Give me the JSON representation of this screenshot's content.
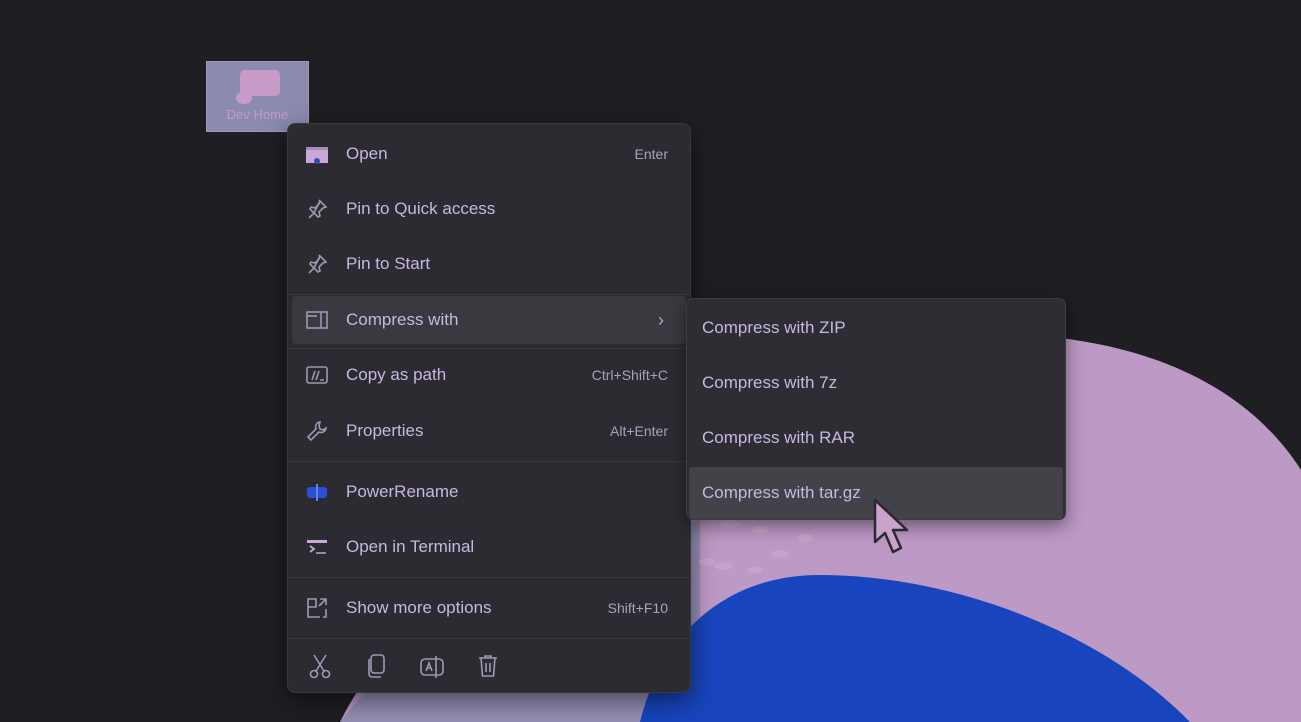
{
  "desktop": {
    "background_color": "#1f1e23",
    "selected_icon": {
      "label": "Dev Home",
      "icon": "dev-home-icon"
    }
  },
  "context_menu": {
    "items": [
      {
        "label": "Open",
        "shortcut": "Enter",
        "icon": "folder-open-icon"
      },
      {
        "label": "Pin to Quick access",
        "shortcut": "",
        "icon": "pin-icon"
      },
      {
        "label": "Pin to Start",
        "shortcut": "",
        "icon": "pin-icon"
      },
      {
        "label": "Compress with",
        "shortcut": "",
        "icon": "archive-icon",
        "has_submenu": true,
        "state": "hover"
      },
      {
        "label": "Copy as path",
        "shortcut": "Ctrl+Shift+C",
        "icon": "copy-path-icon"
      },
      {
        "label": "Properties",
        "shortcut": "Alt+Enter",
        "icon": "wrench-icon"
      },
      {
        "label": "PowerRename",
        "shortcut": "",
        "icon": "power-rename-icon"
      },
      {
        "label": "Open in Terminal",
        "shortcut": "",
        "icon": "terminal-icon"
      },
      {
        "label": "Show more options",
        "shortcut": "Shift+F10",
        "icon": "show-more-icon"
      }
    ],
    "chevron": "›",
    "bottom_actions": [
      {
        "name": "cut",
        "icon": "scissors-icon"
      },
      {
        "name": "copy",
        "icon": "copy-icon"
      },
      {
        "name": "rename",
        "icon": "rename-icon"
      },
      {
        "name": "delete",
        "icon": "trash-icon"
      }
    ]
  },
  "submenu": {
    "items": [
      {
        "label": "Compress with ZIP"
      },
      {
        "label": "Compress with 7z"
      },
      {
        "label": "Compress with RAR"
      },
      {
        "label": "Compress with tar.gz",
        "state": "hover"
      }
    ]
  },
  "colors": {
    "menu_bg": "#2c2b31",
    "menu_text": "#c8b7e0",
    "hover_bg": "#3a3940",
    "wallpaper_pink": "#bd99c5",
    "wallpaper_blue": "#1845bd"
  }
}
